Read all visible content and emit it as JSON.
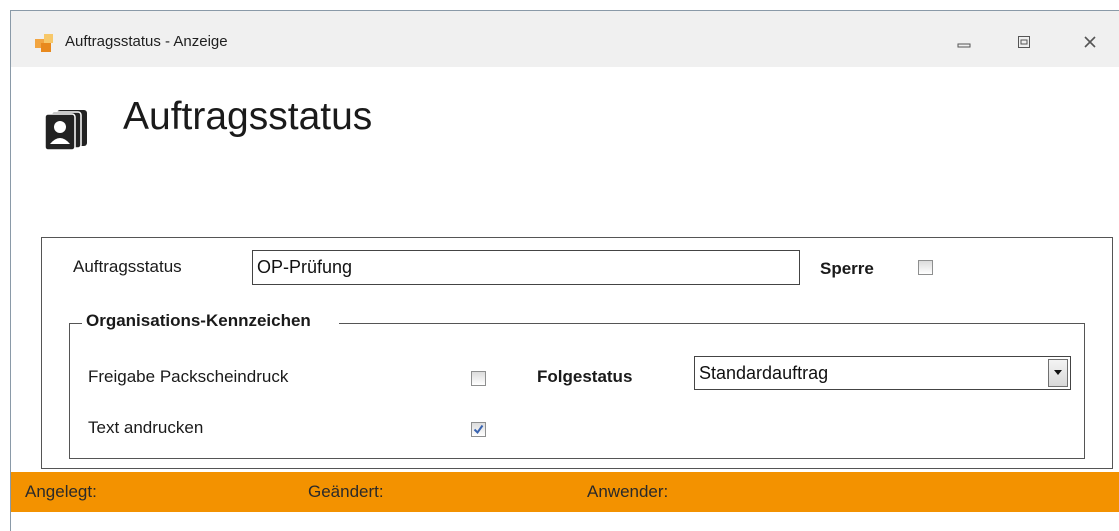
{
  "window": {
    "title": "Auftragsstatus - Anzeige"
  },
  "header": {
    "title": "Auftragsstatus"
  },
  "form": {
    "status_label": "Auftragsstatus",
    "status_value": "OP-Prüfung",
    "lock_label": "Sperre",
    "lock_checked": false
  },
  "org_group": {
    "legend": "Organisations-Kennzeichen",
    "packing_label": "Freigabe Packscheindruck",
    "packing_checked": false,
    "print_text_label": "Text andrucken",
    "print_text_checked": true,
    "next_status_label": "Folgestatus",
    "next_status_value": "Standardauftrag"
  },
  "statusbar": {
    "created_label": "Angelegt:",
    "changed_label": "Geändert:",
    "user_label": "Anwender:"
  },
  "colors": {
    "accent": "#f39200",
    "check": "#3a64b0"
  }
}
